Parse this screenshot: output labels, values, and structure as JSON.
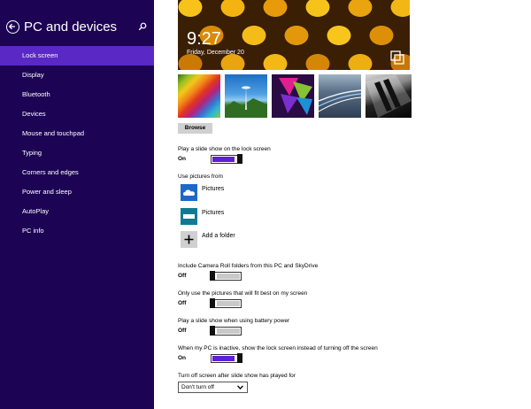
{
  "sidebar": {
    "title": "PC and devices",
    "items": [
      {
        "label": "Lock screen",
        "active": true
      },
      {
        "label": "Display"
      },
      {
        "label": "Bluetooth"
      },
      {
        "label": "Devices"
      },
      {
        "label": "Mouse and touchpad"
      },
      {
        "label": "Typing"
      },
      {
        "label": "Corners and edges"
      },
      {
        "label": "Power and sleep"
      },
      {
        "label": "AutoPlay"
      },
      {
        "label": "PC info"
      }
    ]
  },
  "preview": {
    "time": "9:27",
    "date": "Friday, December 20"
  },
  "browse_label": "Browse",
  "slideshow": {
    "label": "Play a slide show on the lock screen",
    "state": "On"
  },
  "use_pictures": {
    "label": "Use pictures from",
    "sources": [
      {
        "label": "Pictures",
        "icon": "cloud-icon"
      },
      {
        "label": "Pictures",
        "icon": "drive-icon"
      }
    ],
    "add_folder": "Add a folder"
  },
  "settings": {
    "camera_roll": {
      "label": "Include Camera Roll folders from this PC and SkyDrive",
      "state": "Off"
    },
    "best_fit": {
      "label": "Only use the pictures that will fit best on my screen",
      "state": "Off"
    },
    "battery": {
      "label": "Play a slide show when using battery power",
      "state": "Off"
    },
    "inactive": {
      "label": "When my PC is inactive, show the lock screen instead of turning off the screen",
      "state": "On"
    }
  },
  "turn_off": {
    "label": "Turn off screen after slide show has played for",
    "value": "Don't turn off"
  },
  "colors": {
    "sidebar_bg": "#1c0354",
    "active_item": "#5a28c4",
    "toggle_on": "#5f1fd6"
  }
}
